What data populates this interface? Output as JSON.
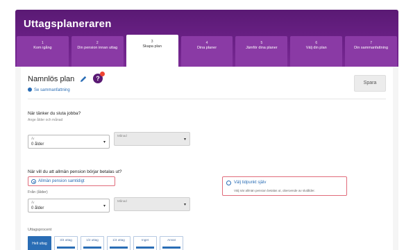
{
  "app": {
    "title": "Uttagsplaneraren"
  },
  "steps": [
    {
      "num": "1",
      "label": "Kom igång"
    },
    {
      "num": "2",
      "label": "Din pension innan uttag"
    },
    {
      "num": "3",
      "label": "Skapa plan"
    },
    {
      "num": "4",
      "label": "Dina planer"
    },
    {
      "num": "5",
      "label": "Jämför dina planer"
    },
    {
      "num": "6",
      "label": "Välj din plan"
    },
    {
      "num": "7",
      "label": "Din sammanfattning"
    }
  ],
  "plan": {
    "name": "Namnlös plan",
    "help_badge": "?",
    "sub_link": "Se sammanfattning",
    "save_label": "Spara"
  },
  "q1": {
    "question": "När tänker du sluta jobba?",
    "hint": "Ange ålder och månad",
    "year_small": "År",
    "year_value": "0 ålder",
    "month_small": "Månad"
  },
  "q2": {
    "question": "När vill du att allmän pension börjar betalas ut?",
    "option_a_label": "Allmän pension samtidigt",
    "option_b_label": "Välj tidpunkt själv",
    "option_b_desc": "Välj när allmän pension betalas ut, oberoende av slutålder.",
    "start_label": "Från (ålder)",
    "start_small": "År",
    "start_value": "0 ålder",
    "start_month_small": "Månad",
    "percent_label": "Uttagsprocent",
    "chips": [
      "Helt uttag",
      "3/4 uttag",
      "1/2 uttag",
      "1/4 uttag",
      "Inget",
      "Annat"
    ]
  }
}
